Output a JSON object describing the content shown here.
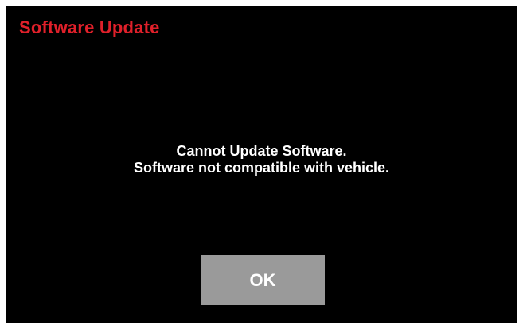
{
  "dialog": {
    "title": "Software Update",
    "message_line1": "Cannot Update Software.",
    "message_line2": "Software not compatible with vehicle.",
    "ok_label": "OK"
  },
  "colors": {
    "background": "#000000",
    "title": "#e0202a",
    "text": "#ffffff",
    "button": "#9a9a9a",
    "frame": "#ffffff"
  }
}
